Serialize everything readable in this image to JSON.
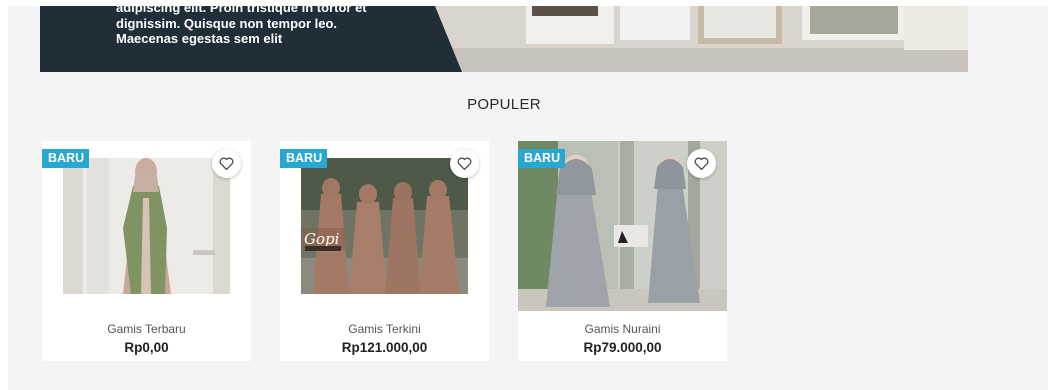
{
  "hero": {
    "lines": [
      "adipiscing elit. Proin tristique in tortor et",
      "dignissim. Quisque non tempor leo.",
      "Maecenas egestas sem elit"
    ]
  },
  "section": {
    "title": "POPULER"
  },
  "products": [
    {
      "name": "Gamis Terbaru",
      "price": "Rp0,00",
      "badge": "BARU"
    },
    {
      "name": "Gamis Terkini",
      "price": "Rp121.000,00",
      "badge": "BARU"
    },
    {
      "name": "Gamis Nuraini",
      "price": "Rp79.000,00",
      "badge": "BARU"
    }
  ],
  "colors": {
    "badge": "#2aa7cf",
    "hero_dark": "#1f2e37",
    "page_bg": "#f4f4f4"
  },
  "icons": {
    "wishlist": "heart-icon"
  }
}
